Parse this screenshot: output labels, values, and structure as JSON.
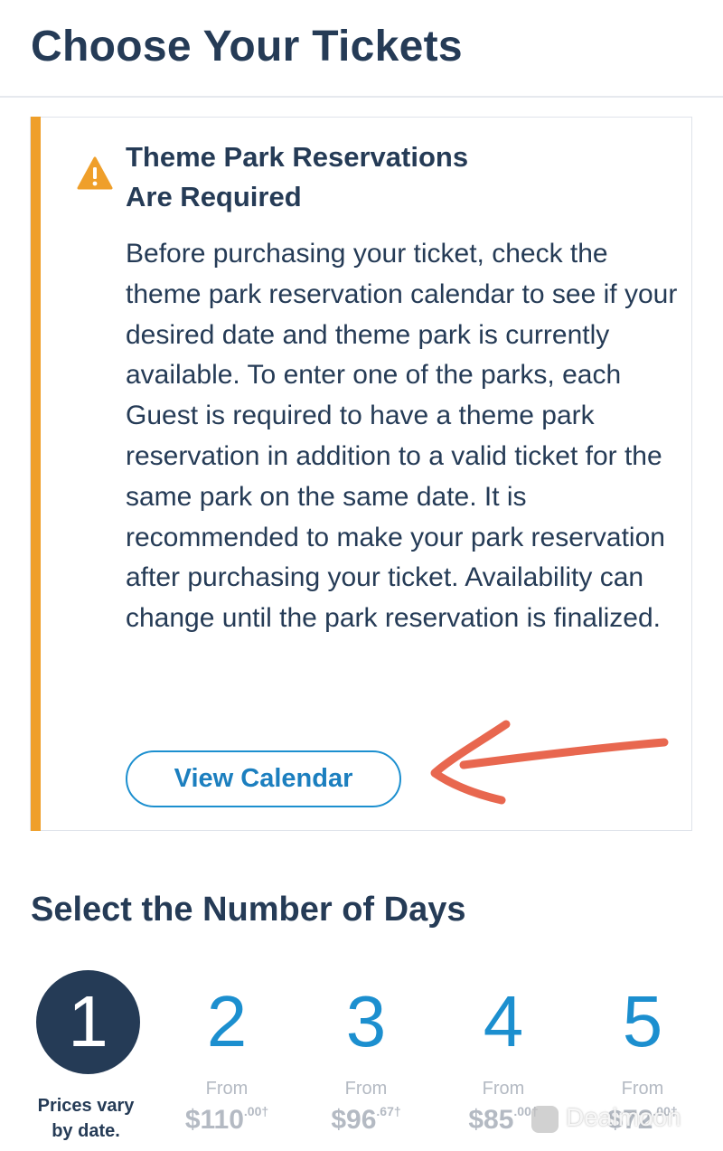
{
  "header": {
    "title": "Choose Your Tickets"
  },
  "alert": {
    "heading_line1": "Theme Park Reservations",
    "heading_line2": "Are Required",
    "body": "Before purchasing your ticket, check the theme park reservation calendar to see if your desired date and theme park is currently available. To enter one of the parks, each Guest is required to have a theme park reservation in addition to a valid ticket for the same park on the same date. It is recommended to make your park reservation after purchasing your ticket. Availability can change until the park reservation is finalized.",
    "button_label": "View Calendar",
    "accent_color": "#ef9f2a",
    "icon": "warning-icon"
  },
  "days_section": {
    "heading": "Select the Number of Days",
    "options": [
      {
        "number": "1",
        "selected": true,
        "note_line1": "Prices vary",
        "note_line2": "by date."
      },
      {
        "number": "2",
        "from": "From",
        "price": "$110",
        "cents": ".00†"
      },
      {
        "number": "3",
        "from": "From",
        "price": "$96",
        "cents": ".67†"
      },
      {
        "number": "4",
        "from": "From",
        "price": "$85",
        "cents": ".00†"
      },
      {
        "number": "5",
        "from": "From",
        "price": "$72",
        "cents": ".00†"
      }
    ]
  },
  "annotation": {
    "type": "hand-drawn arrow",
    "color": "#e8674f"
  },
  "watermark": {
    "text": "Dealmoon"
  },
  "colors": {
    "navy": "#253b56",
    "blue": "#1c8fcf",
    "muted": "#b4bac3"
  }
}
